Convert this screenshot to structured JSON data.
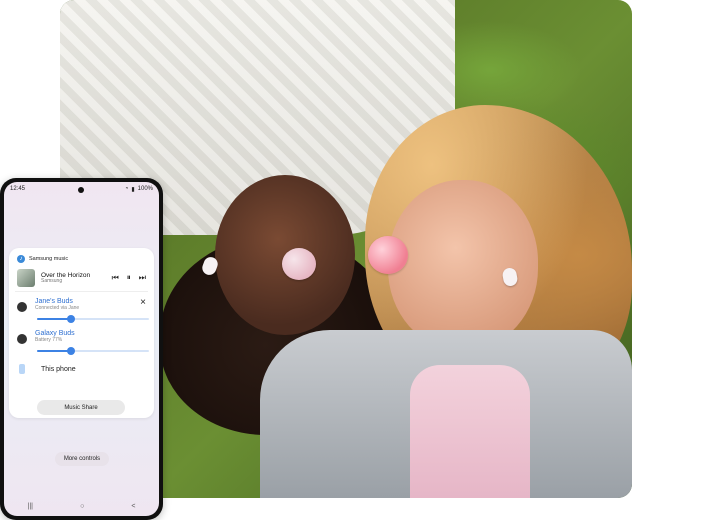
{
  "status_bar": {
    "time": "12:45",
    "battery": "100%"
  },
  "music": {
    "app": "Samsung music",
    "track_title": "Over the Horizon",
    "track_artist": "Samsung",
    "controls": {
      "prev": "⏮",
      "pause": "⏸",
      "next": "⏭"
    }
  },
  "devices": [
    {
      "name": "Jane's Buds",
      "sub": "Connected via Jane",
      "volume": 0.3
    },
    {
      "name": "Galaxy Buds",
      "sub": "Battery 77%",
      "volume": 0.3
    }
  ],
  "this_phone": "This phone",
  "buttons": {
    "music_share": "Music Share",
    "more_controls": "More controls",
    "close": "×"
  },
  "nav": {
    "recent": "|||",
    "home": "○",
    "back": "<"
  },
  "colors": {
    "accent": "#3c82e4",
    "title_blue": "#2f70d1"
  }
}
